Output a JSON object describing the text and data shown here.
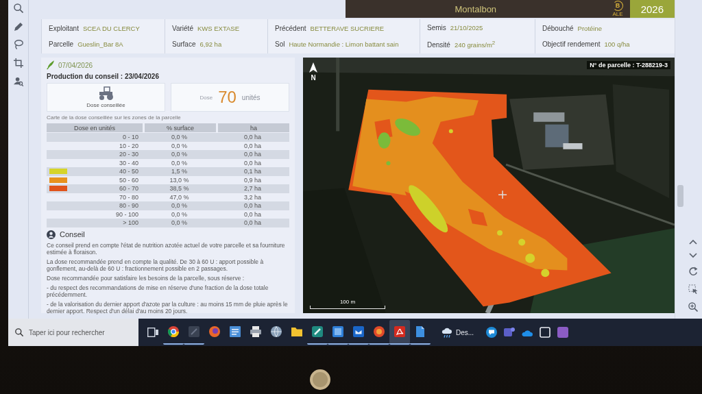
{
  "header": {
    "title": "Montalbon",
    "logo": {
      "mark": "B",
      "name": "ALE"
    },
    "year": "2026"
  },
  "info_columns": [
    [
      {
        "label": "Exploitant",
        "value": "SCEA DU CLERCY"
      },
      {
        "label": "Parcelle",
        "value": "Gueslin_Bar 8A"
      }
    ],
    [
      {
        "label": "Variété",
        "value": "KWS EXTASE"
      },
      {
        "label": "Surface",
        "value": "6,92 ha"
      }
    ],
    [
      {
        "label": "Précédent",
        "value": "BETTERAVE SUCRIERE"
      },
      {
        "label": "Sol",
        "value": "Haute Normandie : Limon battant sain"
      }
    ],
    [
      {
        "label": "Semis",
        "value": "21/10/2025"
      },
      {
        "label": "Densité",
        "value": "240 grains/m$^{2}$"
      }
    ],
    [
      {
        "label": "Débouché",
        "value": "Protéine"
      },
      {
        "label": "Objectif rendement",
        "value": "100 q/ha"
      }
    ]
  ],
  "advice": {
    "date": "07/04/2026",
    "production": "Production du conseil : 23/04/2026",
    "dose_label": "Dose conseillée",
    "dose_caption": "Dose",
    "dose_value": "70",
    "dose_unit": "unités",
    "table_caption": "Carte de la dose conseillée sur les zones de la parcelle",
    "table": {
      "columns": [
        "Dose en unités",
        "% surface",
        "ha"
      ],
      "rows": [
        {
          "range": "0 - 10",
          "surface": "0,0 %",
          "ha": "0,0 ha"
        },
        {
          "range": "10 - 20",
          "surface": "0,0 %",
          "ha": "0,0 ha"
        },
        {
          "range": "20 - 30",
          "surface": "0,0 %",
          "ha": "0,0 ha"
        },
        {
          "range": "30 - 40",
          "surface": "0,0 %",
          "ha": "0,0 ha"
        },
        {
          "range": "40 - 50",
          "surface": "1,5 %",
          "ha": "0,1 ha",
          "color": "#d6d42a"
        },
        {
          "range": "50 - 60",
          "surface": "13,0 %",
          "ha": "0,9 ha",
          "color": "#e8921e"
        },
        {
          "range": "60 - 70",
          "surface": "38,5 %",
          "ha": "2,7 ha",
          "color": "#e0541c"
        },
        {
          "range": "70 - 80",
          "surface": "47,0 %",
          "ha": "3,2 ha"
        },
        {
          "range": "80 - 90",
          "surface": "0,0 %",
          "ha": "0,0 ha"
        },
        {
          "range": "90 - 100",
          "surface": "0,0 %",
          "ha": "0,0 ha"
        },
        {
          "range": "> 100",
          "surface": "0,0 %",
          "ha": "0,0 ha"
        }
      ]
    },
    "conseil_title": "Conseil",
    "conseil_text": [
      "Ce conseil prend en compte l'état de nutrition azotée actuel de votre parcelle et sa fourniture estimée à floraison.",
      "La dose recommandée prend en compte la qualité. De 30 à 60 U : apport possible à gonflement, au-delà de 60 U : fractionnement possible en 2 passages.",
      "Dose recommandée pour satisfaire les besoins de la parcelle, sous réserve :",
      "- du respect des recommandations de mise en réserve d'une fraction de la dose totale précédemment.",
      "- de la valorisation du dernier apport d'azote par la culture : au moins 15 mm de pluie après le dernier apport. Respect d'un délai d'au moins 20 jours."
    ]
  },
  "map": {
    "north_label": "N",
    "parcel_label": "N° de parcelle : T-288219-3",
    "scale_label": "100 m"
  },
  "taskbar": {
    "search": {
      "placeholder": "Taper ici pour rechercher"
    },
    "apps": [
      {
        "kind": "browser",
        "open": true,
        "active": false
      },
      {
        "kind": "dark",
        "open": true,
        "active": false
      },
      {
        "kind": "fox",
        "open": false,
        "active": false
      },
      {
        "kind": "notepad",
        "open": false,
        "active": false
      },
      {
        "kind": "printer",
        "open": false,
        "active": false
      },
      {
        "kind": "globe",
        "open": false,
        "active": false
      },
      {
        "kind": "folder",
        "open": false,
        "active": false
      },
      {
        "kind": "pen",
        "open": true,
        "active": false
      },
      {
        "kind": "tile",
        "open": true,
        "active": false
      },
      {
        "kind": "mail",
        "open": true,
        "active": false
      },
      {
        "kind": "disc",
        "open": true,
        "active": false
      },
      {
        "kind": "pdf",
        "open": true,
        "active": true
      },
      {
        "kind": "doc",
        "open": true,
        "active": false
      }
    ],
    "weather": "Des...",
    "tray": [
      {
        "kind": "chat"
      },
      {
        "kind": "team"
      },
      {
        "kind": "cloud"
      },
      {
        "kind": "frame"
      },
      {
        "kind": "app"
      }
    ]
  }
}
